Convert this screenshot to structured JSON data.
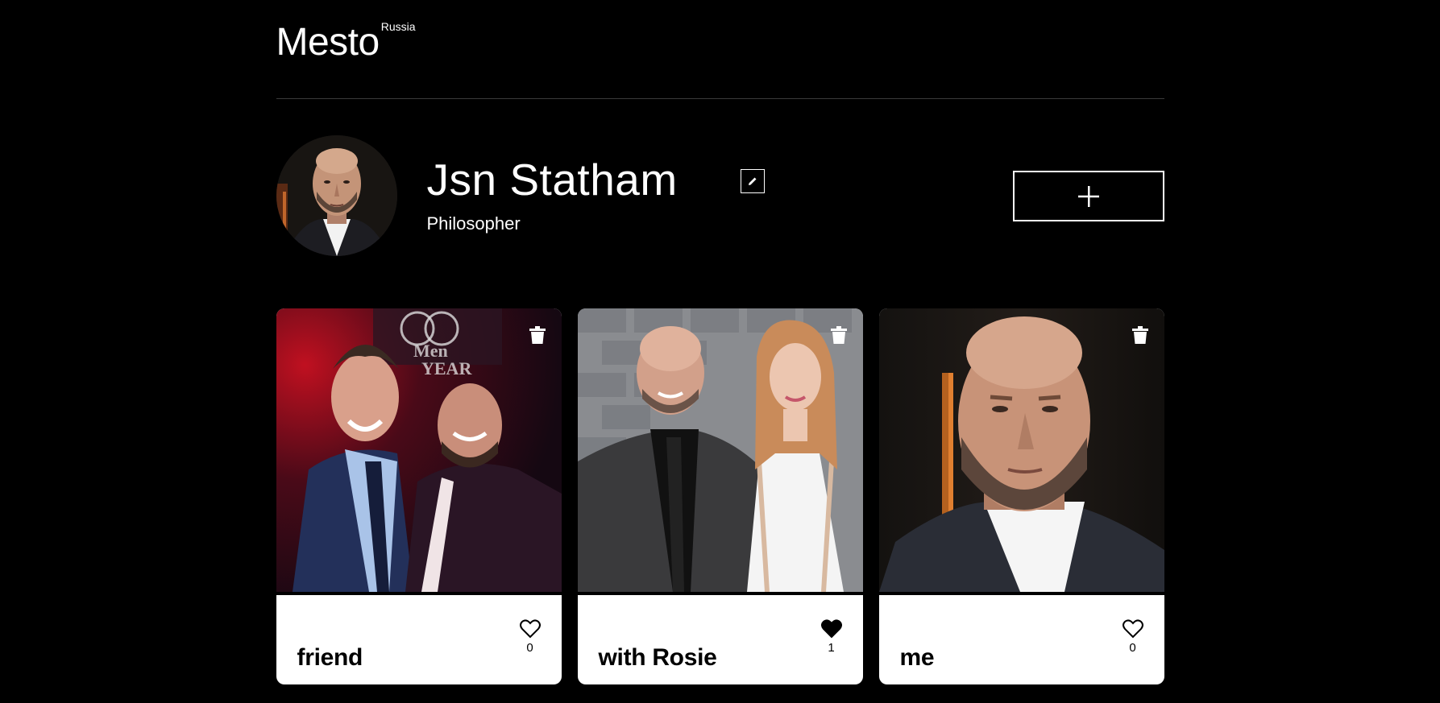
{
  "header": {
    "logo": "Mesto",
    "logo_sup": "Russia"
  },
  "profile": {
    "name": "Jsn Statham",
    "job": "Philosopher",
    "edit_icon": "pencil-icon",
    "add_icon": "plus-icon"
  },
  "cards": [
    {
      "title": "friend",
      "likes": "0",
      "liked": false,
      "delete_icon": "trash-icon"
    },
    {
      "title": "with Rosie",
      "likes": "1",
      "liked": true,
      "delete_icon": "trash-icon"
    },
    {
      "title": "me",
      "likes": "0",
      "liked": false,
      "delete_icon": "trash-icon"
    }
  ]
}
